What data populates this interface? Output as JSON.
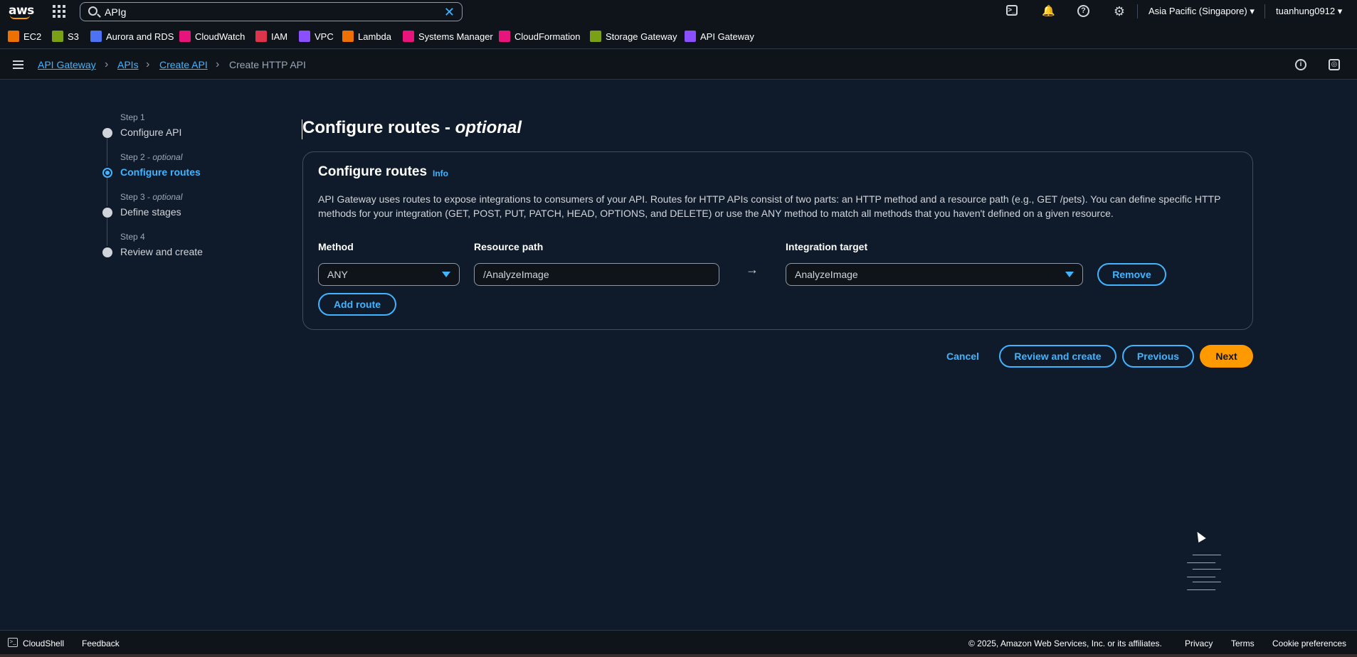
{
  "topnav": {
    "search_value": "APIg",
    "region": "Asia Pacific (Singapore) ▾",
    "user": "tuanhung0912 ▾"
  },
  "favorites": [
    {
      "label": "EC2",
      "color": "#ed7100"
    },
    {
      "label": "S3",
      "color": "#7aa116"
    },
    {
      "label": "Aurora and RDS",
      "color": "#4d72f3"
    },
    {
      "label": "CloudWatch",
      "color": "#e7157b"
    },
    {
      "label": "IAM",
      "color": "#dd344c"
    },
    {
      "label": "VPC",
      "color": "#8c4fff"
    },
    {
      "label": "Lambda",
      "color": "#ed7100"
    },
    {
      "label": "Systems Manager",
      "color": "#e7157b"
    },
    {
      "label": "CloudFormation",
      "color": "#e7157b"
    },
    {
      "label": "Storage Gateway",
      "color": "#7aa116"
    },
    {
      "label": "API Gateway",
      "color": "#8c4fff"
    }
  ],
  "breadcrumb": {
    "items": [
      "API Gateway",
      "APIs",
      "Create API"
    ],
    "current": "Create HTTP API"
  },
  "steps": [
    {
      "label": "Step 1",
      "optional": "",
      "title": "Configure API"
    },
    {
      "label": "Step 2 - ",
      "optional": "optional",
      "title": "Configure routes"
    },
    {
      "label": "Step 3 - ",
      "optional": "optional",
      "title": "Define stages"
    },
    {
      "label": "Step 4",
      "optional": "",
      "title": "Review and create"
    }
  ],
  "main": {
    "title": "Configure routes - ",
    "title_optional": "optional",
    "panel_title": "Configure routes",
    "info": "Info",
    "description": "API Gateway uses routes to expose integrations to consumers of your API. Routes for HTTP APIs consist of two parts: an HTTP method and a resource path (e.g., GET /pets). You can define specific HTTP methods for your integration (GET, POST, PUT, PATCH, HEAD, OPTIONS, and DELETE) or use the ANY method to match all methods that you haven't defined on a given resource.",
    "method_label": "Method",
    "method_value": "ANY",
    "path_label": "Resource path",
    "path_value": "/AnalyzeImage",
    "arrow": "→",
    "target_label": "Integration target",
    "target_value": "AnalyzeImage",
    "remove": "Remove",
    "add_route": "Add route"
  },
  "actions": {
    "cancel": "Cancel",
    "review": "Review and create",
    "previous": "Previous",
    "next": "Next"
  },
  "footer": {
    "cloudshell": "CloudShell",
    "feedback": "Feedback",
    "copyright": "© 2025, Amazon Web Services, Inc. or its affiliates.",
    "privacy": "Privacy",
    "terms": "Terms",
    "cookies": "Cookie preferences"
  }
}
